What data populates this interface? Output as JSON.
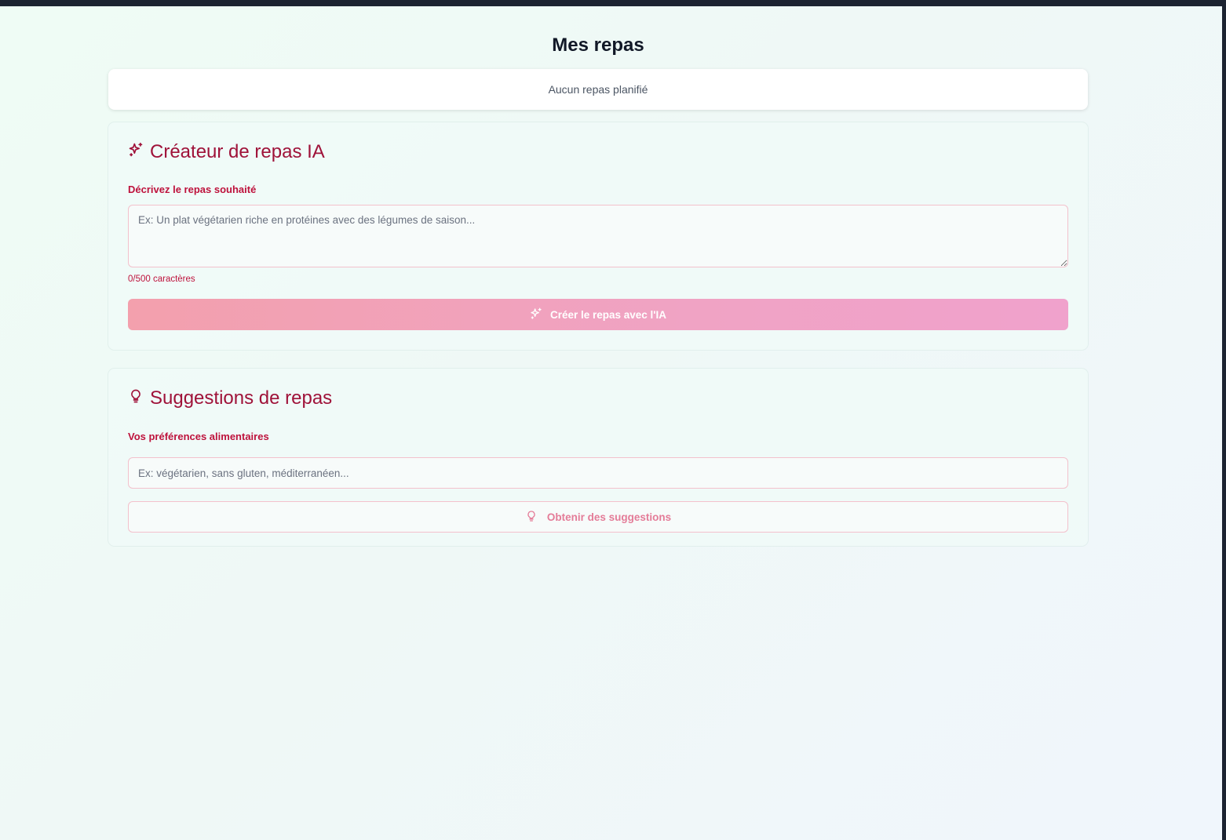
{
  "page": {
    "title": "Mes repas"
  },
  "meals": {
    "empty_message": "Aucun repas planifié"
  },
  "creator": {
    "title": "Créateur de repas IA",
    "icon": "sparkles-icon",
    "field_label": "Décrivez le repas souhaité",
    "placeholder": "Ex: Un plat végétarien riche en protéines avec des légumes de saison...",
    "value": "",
    "char_count": "0/500 caractères",
    "button_label": "Créer le repas avec l'IA"
  },
  "suggestions": {
    "title": "Suggestions de repas",
    "icon": "lightbulb-icon",
    "field_label": "Vos préférences alimentaires",
    "placeholder": "Ex: végétarien, sans gluten, méditerranéen...",
    "value": "",
    "button_label": "Obtenir des suggestions"
  },
  "colors": {
    "accent_dark": "#9f1239",
    "accent": "#be123c",
    "button_gradient_start": "#f3a0ad",
    "button_gradient_end": "#f0a2cc",
    "border": "#f3c1cc"
  }
}
